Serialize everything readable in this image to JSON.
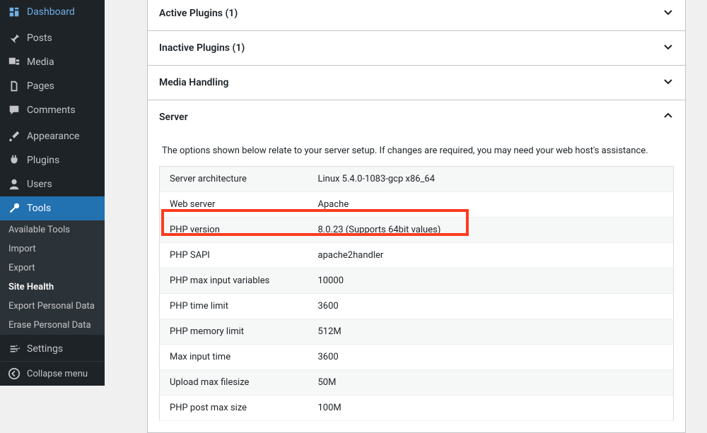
{
  "sidebar": {
    "items": [
      {
        "label": "Dashboard"
      },
      {
        "label": "Posts"
      },
      {
        "label": "Media"
      },
      {
        "label": "Pages"
      },
      {
        "label": "Comments"
      },
      {
        "label": "Appearance"
      },
      {
        "label": "Plugins"
      },
      {
        "label": "Users"
      },
      {
        "label": "Tools"
      },
      {
        "label": "Settings"
      }
    ],
    "tools_submenu": [
      {
        "label": "Available Tools"
      },
      {
        "label": "Import"
      },
      {
        "label": "Export"
      },
      {
        "label": "Site Health"
      },
      {
        "label": "Export Personal Data"
      },
      {
        "label": "Erase Personal Data"
      }
    ],
    "collapse_label": "Collapse menu"
  },
  "panels": {
    "active_plugins": "Active Plugins (1)",
    "inactive_plugins": "Inactive Plugins (1)",
    "media_handling": "Media Handling",
    "server": "Server"
  },
  "server_section": {
    "note": "The options shown below relate to your server setup. If changes are required, you may need your web host's assistance.",
    "rows": [
      {
        "k": "Server architecture",
        "v": "Linux 5.4.0-1083-gcp x86_64"
      },
      {
        "k": "Web server",
        "v": "Apache"
      },
      {
        "k": "PHP version",
        "v": "8.0.23 (Supports 64bit values)"
      },
      {
        "k": "PHP SAPI",
        "v": "apache2handler"
      },
      {
        "k": "PHP max input variables",
        "v": "10000"
      },
      {
        "k": "PHP time limit",
        "v": "3600"
      },
      {
        "k": "PHP memory limit",
        "v": "512M"
      },
      {
        "k": "Max input time",
        "v": "3600"
      },
      {
        "k": "Upload max filesize",
        "v": "50M"
      },
      {
        "k": "PHP post max size",
        "v": "100M"
      }
    ]
  }
}
